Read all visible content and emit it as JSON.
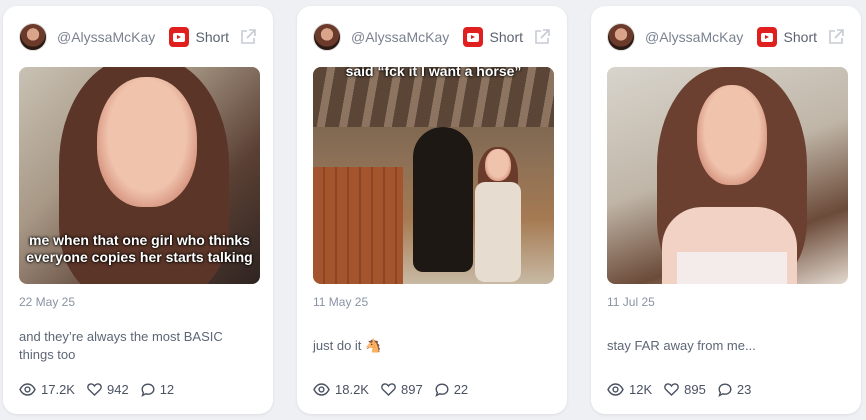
{
  "cards": [
    {
      "handle": "@AlyssaMcKay",
      "platform": "Short",
      "caption": "me when that one girl who thinks everyone copies her starts talking",
      "date": "22 May 25",
      "description": "and they’re always the most BASIC things too",
      "views": "17.2K",
      "likes": "942",
      "comments": "12"
    },
    {
      "handle": "@AlyssaMcKay",
      "platform": "Short",
      "caption": "said “fck it I want a horse”",
      "date": "11 May 25",
      "description": "just do it 🐴",
      "views": "18.2K",
      "likes": "897",
      "comments": "22"
    },
    {
      "handle": "@AlyssaMcKay",
      "platform": "Short",
      "caption": "",
      "date": "11 Jul 25",
      "description": "stay FAR away from me...",
      "views": "12K",
      "likes": "895",
      "comments": "23"
    }
  ],
  "icons": {
    "platform": "youtube-icon",
    "external": "external-link-icon",
    "views": "eye-icon",
    "likes": "heart-icon",
    "comments": "comment-icon"
  },
  "colors": {
    "youtube_red": "#e0201f",
    "background": "#eef0f4",
    "card": "#ffffff"
  }
}
